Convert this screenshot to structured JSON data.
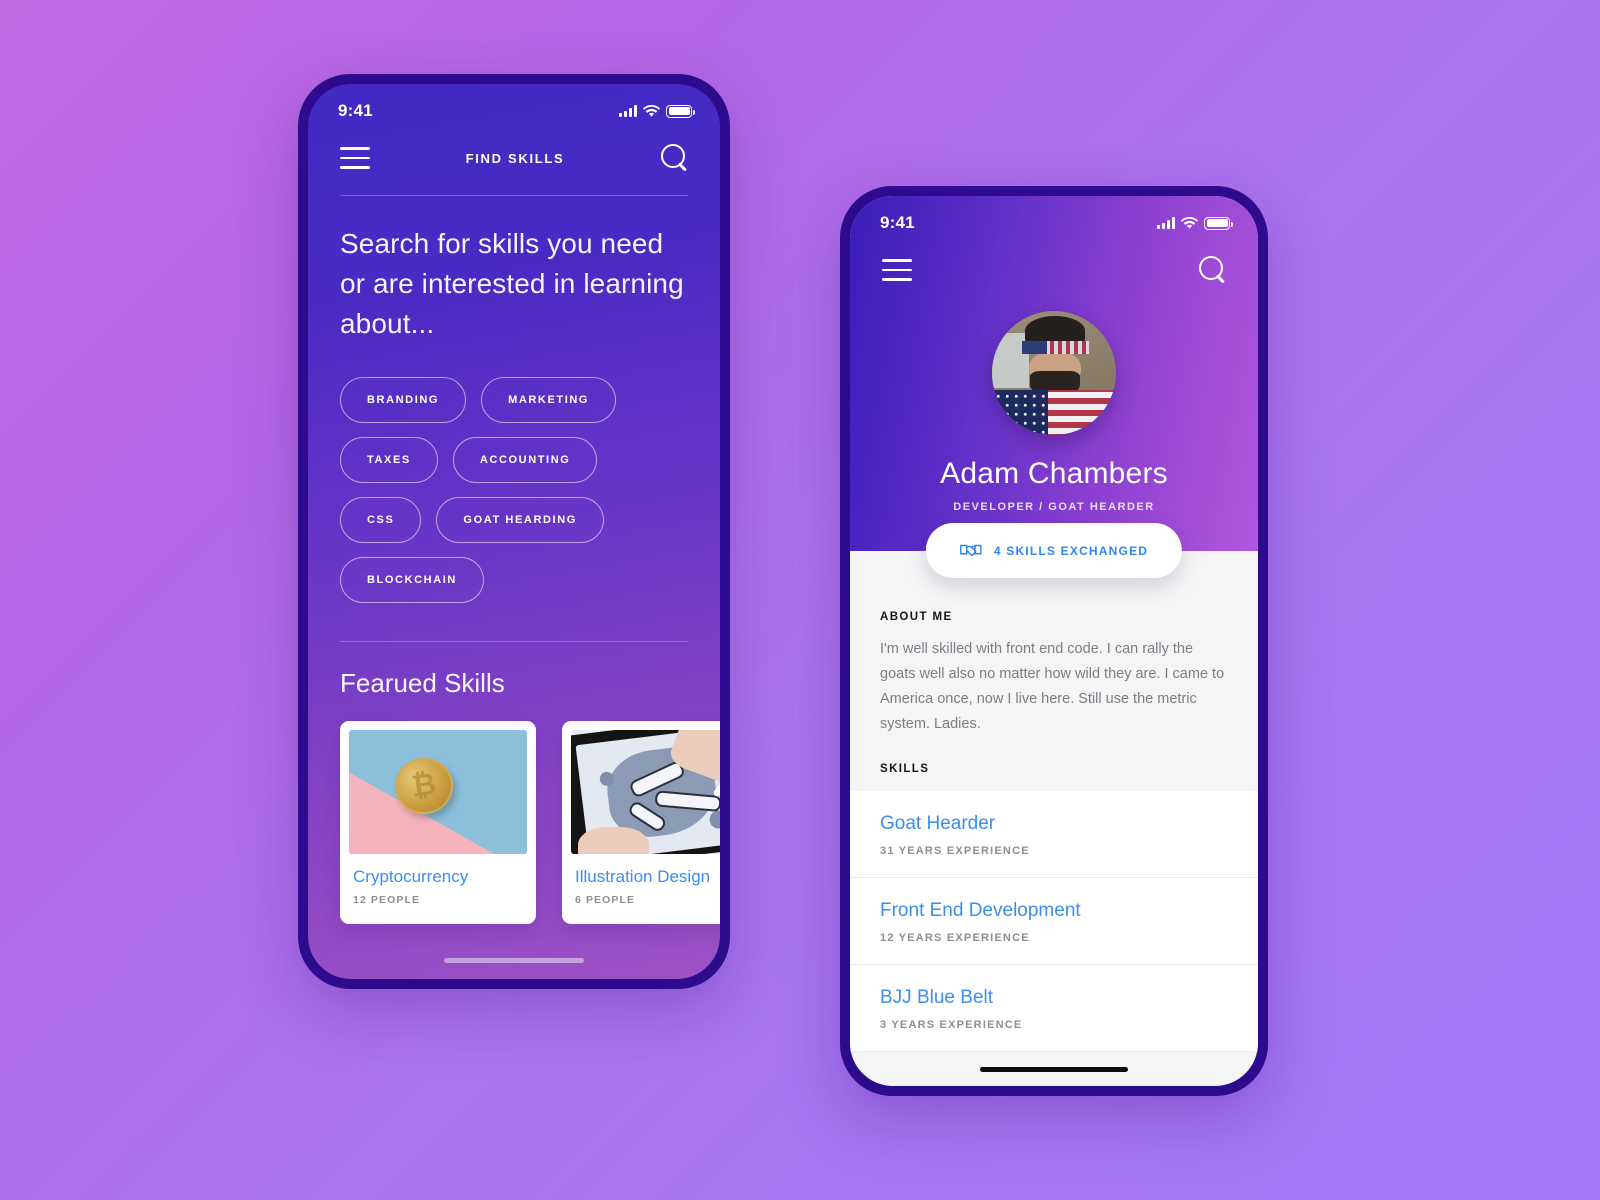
{
  "find_skills": {
    "statusbar": {
      "time": "9:41"
    },
    "nav": {
      "title": "FIND SKILLS",
      "menu_icon": "hamburger-menu-icon",
      "search_icon": "search-icon"
    },
    "heading": "Search for skills you need or are interested in learning about...",
    "tags": [
      {
        "label": "BRANDING"
      },
      {
        "label": "MARKETING"
      },
      {
        "label": "TAXES"
      },
      {
        "label": "ACCOUNTING"
      },
      {
        "label": "CSS"
      },
      {
        "label": "GOAT HEARDING"
      },
      {
        "label": "BLOCKCHAIN"
      }
    ],
    "featured": {
      "title": "Fearued Skills",
      "cards": [
        {
          "title": "Cryptocurrency",
          "people": "12 PEOPLE",
          "image": "bitcoin-coin-photo"
        },
        {
          "title": "Illustration Design",
          "people": "6 PEOPLE",
          "image": "tablet-illustration-photo"
        }
      ]
    }
  },
  "profile": {
    "statusbar": {
      "time": "9:41"
    },
    "nav": {
      "menu_icon": "hamburger-menu-icon",
      "search_icon": "search-icon"
    },
    "avatar_alt": "adam-chambers-avatar",
    "name": "Adam Chambers",
    "role": "DEVELOPER / GOAT HEARDER",
    "badge": {
      "icon": "handshake-icon",
      "label": "4 SKILLS EXCHANGED"
    },
    "about": {
      "label": "ABOUT ME",
      "text": "I'm well skilled with front end code. I can rally the goats well also no matter how wild they are. I came to America once, now I live here. Still use the metric system. Ladies."
    },
    "skills": {
      "label": "SKILLS",
      "items": [
        {
          "name": "Goat Hearder",
          "experience": "31 YEARS EXPERIENCE"
        },
        {
          "name": "Front End Development",
          "experience": "12 YEARS EXPERIENCE"
        },
        {
          "name": "BJJ Blue Belt",
          "experience": "3 YEARS EXPERIENCE"
        }
      ]
    }
  },
  "colors": {
    "accent_blue": "#3b8ef0",
    "badge_blue": "#2f86f5",
    "bezel": "#2d0b8f",
    "bg_start": "#c06ae2",
    "bg_end": "#a278fa"
  }
}
